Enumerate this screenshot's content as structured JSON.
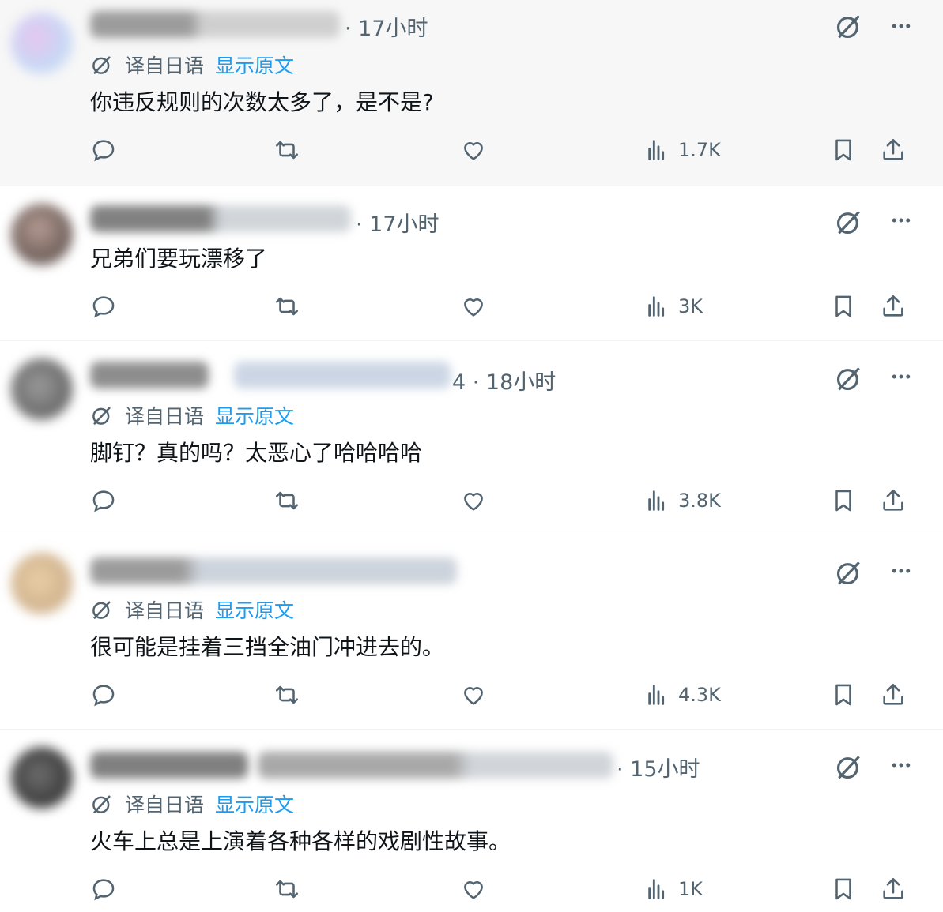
{
  "colors": {
    "text": "#0f1419",
    "muted": "#536471",
    "link": "#1d9bf0",
    "divider": "#eff3f4"
  },
  "icons": {
    "grok": "grok-icon",
    "more": "more-icon",
    "reply": "reply-icon",
    "retweet": "retweet-icon",
    "like": "like-icon",
    "views": "views-icon",
    "bookmark": "bookmark-icon",
    "share": "share-icon",
    "translate": "translate-icon"
  },
  "posts": [
    {
      "time": "· 17小时",
      "translated": true,
      "translate_label": "译自日语",
      "show_original": "显示原文",
      "text": "你违反规则的次数太多了，是不是?",
      "views": "1.7K"
    },
    {
      "time": "· 17小时",
      "translated": false,
      "text": "兄弟们要玩漂移了",
      "views": "3K"
    },
    {
      "time": "4 · 18小时",
      "translated": true,
      "translate_label": "译自日语",
      "show_original": "显示原文",
      "text": "脚钉？真的吗？太恶心了哈哈哈哈",
      "views": "3.8K"
    },
    {
      "time": "",
      "translated": true,
      "translate_label": "译自日语",
      "show_original": "显示原文",
      "text": "很可能是挂着三挡全油门冲进去的。",
      "views": "4.3K"
    },
    {
      "time": "· 15小时",
      "translated": true,
      "translate_label": "译自日语",
      "show_original": "显示原文",
      "text": "火车上总是上演着各种各样的戏剧性故事。",
      "views": "1K"
    }
  ]
}
